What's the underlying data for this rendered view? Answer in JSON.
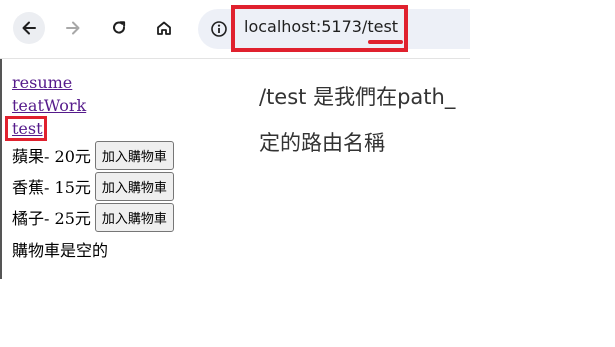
{
  "browser": {
    "url": "localhost:5173/test"
  },
  "nav_links": [
    {
      "label": "resume"
    },
    {
      "label": "teatWork"
    },
    {
      "label": "test"
    }
  ],
  "products": [
    {
      "name": "蘋果",
      "price": " - 20元",
      "button": "加入購物車"
    },
    {
      "name": "香蕉",
      "price": " - 15元",
      "button": "加入購物車"
    },
    {
      "name": "橘子",
      "price": " - 25元",
      "button": "加入購物車"
    }
  ],
  "cart": {
    "status": "購物車是空的"
  },
  "annotation": {
    "line1": "/test 是我們在path_",
    "line2": "定的路由名稱"
  },
  "colors": {
    "highlight": "#e0212e",
    "visited_link": "#551a8b"
  }
}
